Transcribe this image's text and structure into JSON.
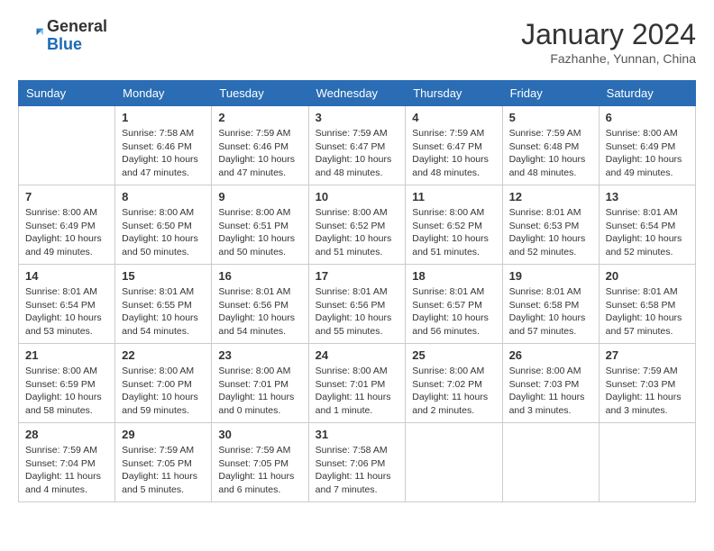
{
  "header": {
    "logo_general": "General",
    "logo_blue": "Blue",
    "title": "January 2024",
    "subtitle": "Fazhanhe, Yunnan, China"
  },
  "days": [
    "Sunday",
    "Monday",
    "Tuesday",
    "Wednesday",
    "Thursday",
    "Friday",
    "Saturday"
  ],
  "weeks": [
    [
      {
        "day": "",
        "content": ""
      },
      {
        "day": "1",
        "content": "Sunrise: 7:58 AM\nSunset: 6:46 PM\nDaylight: 10 hours\nand 47 minutes."
      },
      {
        "day": "2",
        "content": "Sunrise: 7:59 AM\nSunset: 6:46 PM\nDaylight: 10 hours\nand 47 minutes."
      },
      {
        "day": "3",
        "content": "Sunrise: 7:59 AM\nSunset: 6:47 PM\nDaylight: 10 hours\nand 48 minutes."
      },
      {
        "day": "4",
        "content": "Sunrise: 7:59 AM\nSunset: 6:47 PM\nDaylight: 10 hours\nand 48 minutes."
      },
      {
        "day": "5",
        "content": "Sunrise: 7:59 AM\nSunset: 6:48 PM\nDaylight: 10 hours\nand 48 minutes."
      },
      {
        "day": "6",
        "content": "Sunrise: 8:00 AM\nSunset: 6:49 PM\nDaylight: 10 hours\nand 49 minutes."
      }
    ],
    [
      {
        "day": "7",
        "content": "Sunrise: 8:00 AM\nSunset: 6:49 PM\nDaylight: 10 hours\nand 49 minutes."
      },
      {
        "day": "8",
        "content": "Sunrise: 8:00 AM\nSunset: 6:50 PM\nDaylight: 10 hours\nand 50 minutes."
      },
      {
        "day": "9",
        "content": "Sunrise: 8:00 AM\nSunset: 6:51 PM\nDaylight: 10 hours\nand 50 minutes."
      },
      {
        "day": "10",
        "content": "Sunrise: 8:00 AM\nSunset: 6:52 PM\nDaylight: 10 hours\nand 51 minutes."
      },
      {
        "day": "11",
        "content": "Sunrise: 8:00 AM\nSunset: 6:52 PM\nDaylight: 10 hours\nand 51 minutes."
      },
      {
        "day": "12",
        "content": "Sunrise: 8:01 AM\nSunset: 6:53 PM\nDaylight: 10 hours\nand 52 minutes."
      },
      {
        "day": "13",
        "content": "Sunrise: 8:01 AM\nSunset: 6:54 PM\nDaylight: 10 hours\nand 52 minutes."
      }
    ],
    [
      {
        "day": "14",
        "content": "Sunrise: 8:01 AM\nSunset: 6:54 PM\nDaylight: 10 hours\nand 53 minutes."
      },
      {
        "day": "15",
        "content": "Sunrise: 8:01 AM\nSunset: 6:55 PM\nDaylight: 10 hours\nand 54 minutes."
      },
      {
        "day": "16",
        "content": "Sunrise: 8:01 AM\nSunset: 6:56 PM\nDaylight: 10 hours\nand 54 minutes."
      },
      {
        "day": "17",
        "content": "Sunrise: 8:01 AM\nSunset: 6:56 PM\nDaylight: 10 hours\nand 55 minutes."
      },
      {
        "day": "18",
        "content": "Sunrise: 8:01 AM\nSunset: 6:57 PM\nDaylight: 10 hours\nand 56 minutes."
      },
      {
        "day": "19",
        "content": "Sunrise: 8:01 AM\nSunset: 6:58 PM\nDaylight: 10 hours\nand 57 minutes."
      },
      {
        "day": "20",
        "content": "Sunrise: 8:01 AM\nSunset: 6:58 PM\nDaylight: 10 hours\nand 57 minutes."
      }
    ],
    [
      {
        "day": "21",
        "content": "Sunrise: 8:00 AM\nSunset: 6:59 PM\nDaylight: 10 hours\nand 58 minutes."
      },
      {
        "day": "22",
        "content": "Sunrise: 8:00 AM\nSunset: 7:00 PM\nDaylight: 10 hours\nand 59 minutes."
      },
      {
        "day": "23",
        "content": "Sunrise: 8:00 AM\nSunset: 7:01 PM\nDaylight: 11 hours\nand 0 minutes."
      },
      {
        "day": "24",
        "content": "Sunrise: 8:00 AM\nSunset: 7:01 PM\nDaylight: 11 hours\nand 1 minute."
      },
      {
        "day": "25",
        "content": "Sunrise: 8:00 AM\nSunset: 7:02 PM\nDaylight: 11 hours\nand 2 minutes."
      },
      {
        "day": "26",
        "content": "Sunrise: 8:00 AM\nSunset: 7:03 PM\nDaylight: 11 hours\nand 3 minutes."
      },
      {
        "day": "27",
        "content": "Sunrise: 7:59 AM\nSunset: 7:03 PM\nDaylight: 11 hours\nand 3 minutes."
      }
    ],
    [
      {
        "day": "28",
        "content": "Sunrise: 7:59 AM\nSunset: 7:04 PM\nDaylight: 11 hours\nand 4 minutes."
      },
      {
        "day": "29",
        "content": "Sunrise: 7:59 AM\nSunset: 7:05 PM\nDaylight: 11 hours\nand 5 minutes."
      },
      {
        "day": "30",
        "content": "Sunrise: 7:59 AM\nSunset: 7:05 PM\nDaylight: 11 hours\nand 6 minutes."
      },
      {
        "day": "31",
        "content": "Sunrise: 7:58 AM\nSunset: 7:06 PM\nDaylight: 11 hours\nand 7 minutes."
      },
      {
        "day": "",
        "content": ""
      },
      {
        "day": "",
        "content": ""
      },
      {
        "day": "",
        "content": ""
      }
    ]
  ]
}
